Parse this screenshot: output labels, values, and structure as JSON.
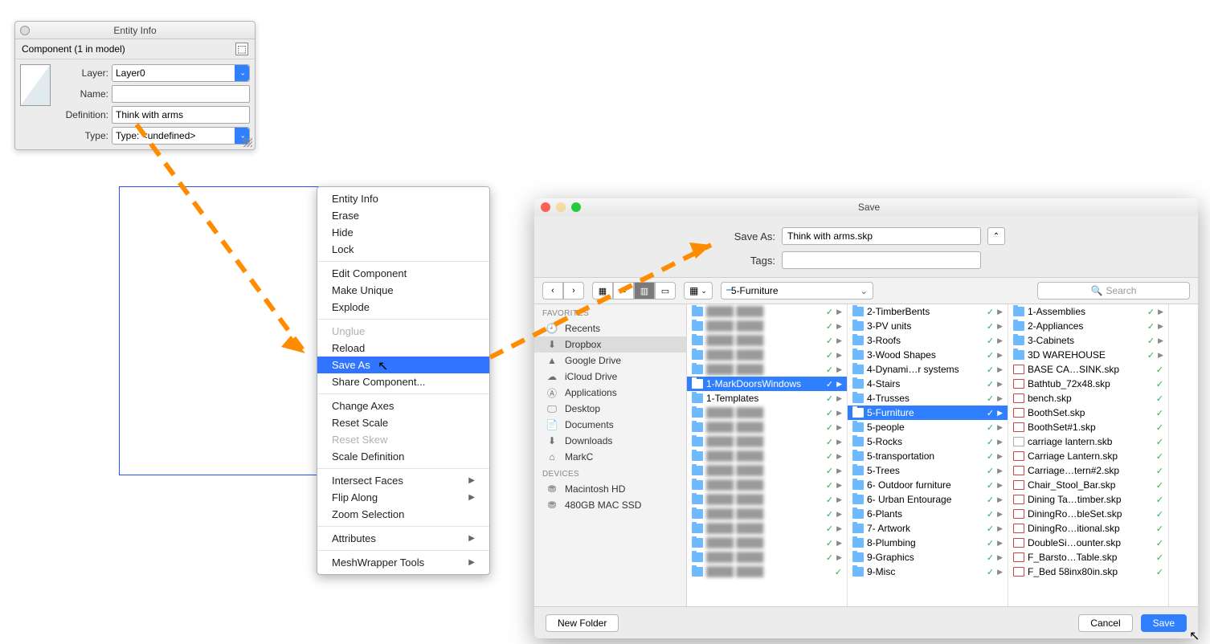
{
  "entityInfo": {
    "title": "Entity Info",
    "header": "Component (1 in model)",
    "fields": {
      "layerLabel": "Layer:",
      "layerValue": "Layer0",
      "nameLabel": "Name:",
      "nameValue": "",
      "definitionLabel": "Definition:",
      "definitionValue": "Think with arms",
      "typeLabel": "Type:",
      "typeValue": "Type: <undefined>"
    }
  },
  "contextMenu": {
    "groups": [
      [
        "Entity Info",
        "Erase",
        "Hide",
        "Lock"
      ],
      [
        "Edit Component",
        "Make Unique",
        "Explode"
      ],
      [
        {
          "t": "Unglue",
          "d": true
        },
        "Reload",
        {
          "t": "Save As",
          "sel": true
        },
        "Share Component..."
      ],
      [
        "Change Axes",
        "Reset Scale",
        {
          "t": "Reset Skew",
          "d": true
        },
        "Scale Definition"
      ],
      [
        {
          "t": "Intersect Faces",
          "sub": true
        },
        {
          "t": "Flip Along",
          "sub": true
        },
        "Zoom Selection"
      ],
      [
        {
          "t": "Attributes",
          "sub": true
        }
      ],
      [
        {
          "t": "MeshWrapper Tools",
          "sub": true
        }
      ]
    ]
  },
  "saveDialog": {
    "title": "Save",
    "saveAsLabel": "Save As:",
    "saveAsValue": "Think with arms.skp",
    "tagsLabel": "Tags:",
    "tagsValue": "",
    "locationDropdown": "5-Furniture",
    "searchPlaceholder": "Search",
    "sidebar": {
      "favoritesHeader": "Favorites",
      "favorites": [
        {
          "icon": "clock",
          "label": "Recents"
        },
        {
          "icon": "dropbox",
          "label": "Dropbox",
          "sel": true
        },
        {
          "icon": "gdrive",
          "label": "Google Drive"
        },
        {
          "icon": "cloud",
          "label": "iCloud Drive"
        },
        {
          "icon": "app",
          "label": "Applications"
        },
        {
          "icon": "desktop",
          "label": "Desktop"
        },
        {
          "icon": "doc",
          "label": "Documents"
        },
        {
          "icon": "down",
          "label": "Downloads"
        },
        {
          "icon": "home",
          "label": "MarkC"
        }
      ],
      "devicesHeader": "Devices",
      "devices": [
        {
          "icon": "disk",
          "label": "Macintosh HD"
        },
        {
          "icon": "disk",
          "label": "480GB MAC SSD"
        }
      ]
    },
    "col1": [
      {
        "t": "",
        "blur": true,
        "chk": true,
        "tri": true
      },
      {
        "t": "",
        "blur": true,
        "chk": true,
        "tri": true
      },
      {
        "t": "",
        "blur": true,
        "chk": true,
        "tri": true
      },
      {
        "t": "",
        "blur": true,
        "chk": true,
        "tri": true
      },
      {
        "t": "",
        "blur": true,
        "chk": true,
        "tri": true
      },
      {
        "t": "1-MarkDoorsWindows",
        "sel": true,
        "chk": true,
        "tri": true
      },
      {
        "t": "1-Templates",
        "chk": true,
        "tri": true
      },
      {
        "t": "",
        "blur": true,
        "chk": true,
        "tri": true
      },
      {
        "t": "",
        "blur": true,
        "chk": true,
        "tri": true
      },
      {
        "t": "",
        "blur": true,
        "chk": true,
        "tri": true
      },
      {
        "t": "",
        "blur": true,
        "chk": true,
        "tri": true
      },
      {
        "t": "",
        "blur": true,
        "chk": true,
        "tri": true
      },
      {
        "t": "",
        "blur": true,
        "chk": true,
        "tri": true
      },
      {
        "t": "",
        "blur": true,
        "chk": true,
        "tri": true
      },
      {
        "t": "",
        "blur": true,
        "chk": true,
        "tri": true
      },
      {
        "t": "",
        "blur": true,
        "chk": true,
        "tri": true
      },
      {
        "t": "",
        "blur": true,
        "chk": true,
        "tri": true
      },
      {
        "t": "",
        "blur": true,
        "chk": true,
        "tri": true
      },
      {
        "t": "",
        "blur": true,
        "chk": true
      }
    ],
    "col2": [
      {
        "t": "2-TimberBents",
        "chk": true,
        "tri": true
      },
      {
        "t": "3-PV units",
        "chk": true,
        "tri": true
      },
      {
        "t": "3-Roofs",
        "chk": true,
        "tri": true
      },
      {
        "t": "3-Wood Shapes",
        "chk": true,
        "tri": true
      },
      {
        "t": "4-Dynami…r systems",
        "chk": true,
        "tri": true
      },
      {
        "t": "4-Stairs",
        "chk": true,
        "tri": true
      },
      {
        "t": "4-Trusses",
        "chk": true,
        "tri": true
      },
      {
        "t": "5-Furniture",
        "sel": true,
        "chk": true,
        "tri": true
      },
      {
        "t": "5-people",
        "chk": true,
        "tri": true
      },
      {
        "t": "5-Rocks",
        "chk": true,
        "tri": true
      },
      {
        "t": "5-transportation",
        "chk": true,
        "tri": true
      },
      {
        "t": "5-Trees",
        "chk": true,
        "tri": true
      },
      {
        "t": "6- Outdoor furniture",
        "chk": true,
        "tri": true
      },
      {
        "t": "6- Urban Entourage",
        "chk": true,
        "tri": true
      },
      {
        "t": "6-Plants",
        "chk": true,
        "tri": true
      },
      {
        "t": "7- Artwork",
        "chk": true,
        "tri": true
      },
      {
        "t": "8-Plumbing",
        "chk": true,
        "tri": true
      },
      {
        "t": "9-Graphics",
        "chk": true,
        "tri": true
      },
      {
        "t": "9-Misc",
        "chk": true,
        "tri": true
      }
    ],
    "col3": [
      {
        "t": "1-Assemblies",
        "folder": true,
        "chk": true,
        "tri": true
      },
      {
        "t": "2-Appliances",
        "folder": true,
        "chk": true,
        "tri": true
      },
      {
        "t": "3-Cabinets",
        "folder": true,
        "chk": true,
        "tri": true
      },
      {
        "t": "3D WAREHOUSE",
        "folder": true,
        "chk": true,
        "tri": true
      },
      {
        "t": "BASE CA…SINK.skp",
        "file": true,
        "chk": true
      },
      {
        "t": "Bathtub_72x48.skp",
        "file": true,
        "chk": true
      },
      {
        "t": "bench.skp",
        "file": true,
        "chk": true
      },
      {
        "t": "BoothSet.skp",
        "file": true,
        "chk": true
      },
      {
        "t": "BoothSet#1.skp",
        "file": true,
        "chk": true
      },
      {
        "t": "carriage lantern.skb",
        "gray": true,
        "chk": true
      },
      {
        "t": "Carriage Lantern.skp",
        "file": true,
        "chk": true
      },
      {
        "t": "Carriage…tern#2.skp",
        "file": true,
        "chk": true
      },
      {
        "t": "Chair_Stool_Bar.skp",
        "file": true,
        "chk": true
      },
      {
        "t": "Dining Ta…timber.skp",
        "file": true,
        "chk": true
      },
      {
        "t": "DiningRo…bleSet.skp",
        "file": true,
        "chk": true
      },
      {
        "t": "DiningRo…itional.skp",
        "file": true,
        "chk": true
      },
      {
        "t": "DoubleSi…ounter.skp",
        "file": true,
        "chk": true
      },
      {
        "t": "F_Barsto…Table.skp",
        "file": true,
        "chk": true
      },
      {
        "t": "F_Bed 58inx80in.skp",
        "file": true,
        "chk": true
      }
    ],
    "footer": {
      "newFolder": "New Folder",
      "cancel": "Cancel",
      "save": "Save"
    }
  }
}
